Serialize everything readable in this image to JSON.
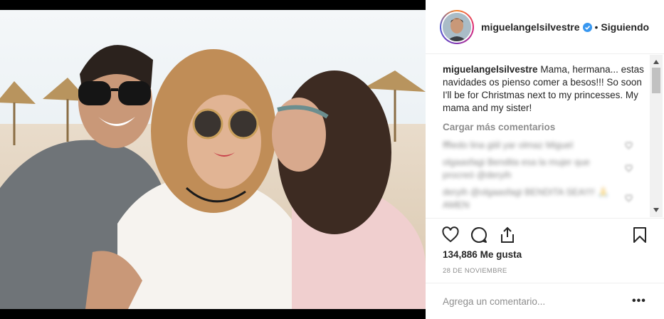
{
  "post": {
    "image_alt": "Three people posing together in the sun on a beach"
  },
  "header": {
    "username": "miguelangelsilvestre",
    "separator": "•",
    "follow_status": "Siguiendo"
  },
  "caption": {
    "username": "miguelangelsilvestre",
    "text": "Mama, hermana... estas navidades os pienso comer a besos!!! So soon I'll be for Christmas next to my princesses. My mama and my sister!"
  },
  "comments": {
    "load_more": "Cargar más comentarios",
    "items": [
      {
        "text": "fffiedo lina giiil yar olmaz Miguel"
      },
      {
        "text": "olgaasfagi Bendita esa la mujer que procreó @deryih"
      },
      {
        "text": "deryih @olgaasfagi BENDITA SEA!!!! 🙏 AMEN"
      }
    ]
  },
  "actions": {
    "likes_count": "134,886",
    "likes_label": "Me gusta",
    "date": "28 DE NOVIEMBRE"
  },
  "add_comment": {
    "placeholder": "Agrega un comentario...",
    "more_label": "•••"
  },
  "colors": {
    "text": "#262626",
    "muted": "#8e8e8e",
    "verified_blue": "#3897f0",
    "border": "#efefef"
  },
  "icons": [
    "verified-badge-icon",
    "heart-icon",
    "comment-icon",
    "share-icon",
    "bookmark-icon",
    "scroll-up-icon",
    "scroll-down-icon"
  ]
}
